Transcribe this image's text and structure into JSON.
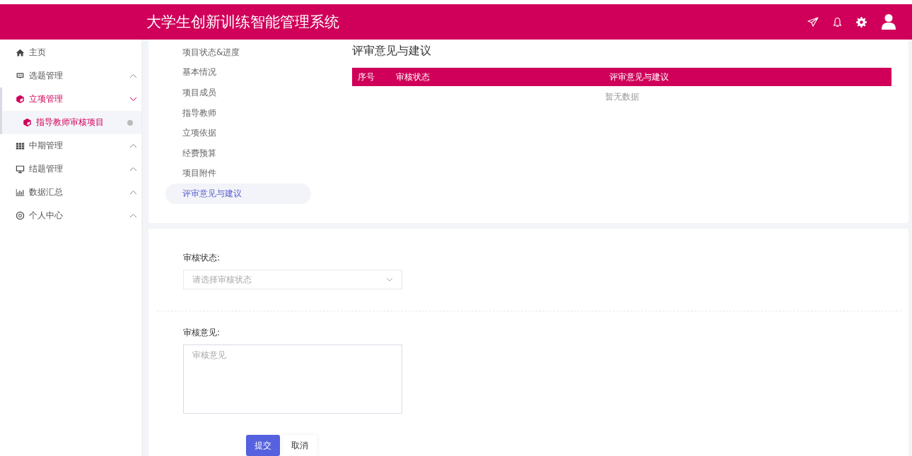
{
  "header": {
    "title": "大学生创新训练智能管理系统"
  },
  "sidebar": {
    "items": [
      {
        "label": "主页",
        "kind": "home",
        "selected": false
      },
      {
        "label": "选题管理",
        "kind": "board",
        "selected": false,
        "expanded": false
      },
      {
        "label": "立项管理",
        "kind": "cube",
        "selected": true,
        "expanded": true,
        "children": [
          {
            "label": "指导教师审核项目",
            "kind": "cube",
            "selected": true
          }
        ]
      },
      {
        "label": "中期管理",
        "kind": "grid",
        "selected": false,
        "expanded": false
      },
      {
        "label": "结题管理",
        "kind": "monitor",
        "selected": false,
        "expanded": false
      },
      {
        "label": "数据汇总",
        "kind": "chart",
        "selected": false,
        "expanded": false
      },
      {
        "label": "个人中心",
        "kind": "gear",
        "selected": false,
        "expanded": false
      }
    ]
  },
  "anchor_nav": [
    {
      "label": "项目状态&进度",
      "selected": false
    },
    {
      "label": "基本情况",
      "selected": false
    },
    {
      "label": "项目成员",
      "selected": false
    },
    {
      "label": "指导教师",
      "selected": false
    },
    {
      "label": "立项依据",
      "selected": false
    },
    {
      "label": "经费预算",
      "selected": false
    },
    {
      "label": "项目附件",
      "selected": false
    },
    {
      "label": "评审意见与建议",
      "selected": true
    }
  ],
  "review_section": {
    "title": "评审意见与建议",
    "table": {
      "columns": [
        "序号",
        "审核状态",
        "评审意见与建议"
      ],
      "empty_text": "暂无数据"
    }
  },
  "form": {
    "fields": [
      {
        "kind": "select",
        "label": "审核状态:",
        "placeholder": "请选择审核状态"
      },
      {
        "kind": "textarea",
        "label": "审核意见:",
        "placeholder": "审核意见"
      }
    ],
    "buttons": [
      {
        "kind": "primary",
        "label": "提交"
      },
      {
        "kind": "default",
        "label": "取消"
      }
    ]
  }
}
